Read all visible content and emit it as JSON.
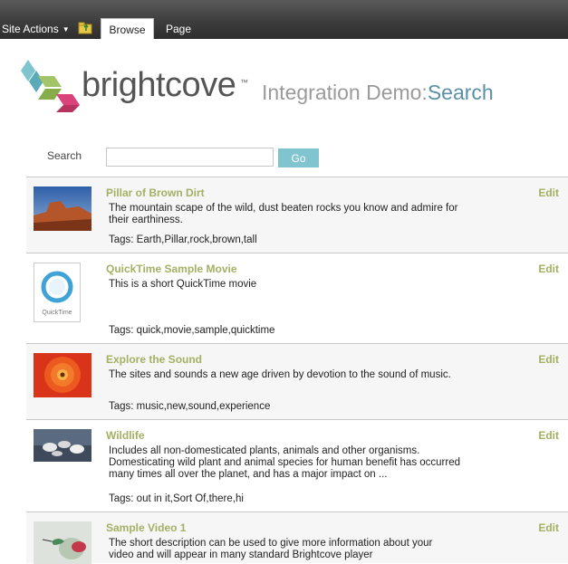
{
  "ribbon": {
    "site_actions": "Site Actions",
    "tabs": [
      "Browse",
      "Page"
    ]
  },
  "header": {
    "logo_text": "brightcove",
    "logo_tm": "™",
    "title_prefix": "Integration Demo:",
    "title_suffix": "Search"
  },
  "search": {
    "label": "Search",
    "value": "",
    "button": "Go"
  },
  "results": [
    {
      "title": "Pillar of Brown Dirt",
      "edit": "Edit",
      "description": "The mountain scape of the wild, dust beaten rocks you know and admire for their earthiness.",
      "tags": "Tags: Earth,Pillar,rock,brown,tall",
      "thumb_icon": "desert-rock-thumbnail"
    },
    {
      "title": "QuickTime Sample Movie",
      "edit": "Edit",
      "description": "This is a short QuickTime movie",
      "tags": "Tags: quick,movie,sample,quicktime",
      "thumb_icon": "quicktime-logo-thumbnail",
      "thumb_caption": "QuickTime"
    },
    {
      "title": "Explore the Sound",
      "edit": "Edit",
      "description": "The sites and sounds a new age driven by devotion to the sound of music.",
      "tags": "Tags: music,new,sound,experience",
      "thumb_icon": "red-flower-thumbnail"
    },
    {
      "title": "Wildlife",
      "edit": "Edit",
      "description": "Includes all non-domesticated plants, animals and other organisms. Domesticating wild plant and animal species for human benefit has occurred many times all over the planet, and has a major impact on ...",
      "tags": "Tags: out in it,Sort Of,there,hi",
      "thumb_icon": "birds-thumbnail"
    },
    {
      "title": "Sample Video 1",
      "edit": "Edit",
      "description": "The short description can be used to give more information about your video and will appear in many standard Brightcove player",
      "tags": "",
      "thumb_icon": "hummingbird-thumbnail"
    }
  ],
  "colors": {
    "accent_green": "#a4b063",
    "title_blue": "#5b8fa8",
    "go_button": "#7fc4cf"
  }
}
